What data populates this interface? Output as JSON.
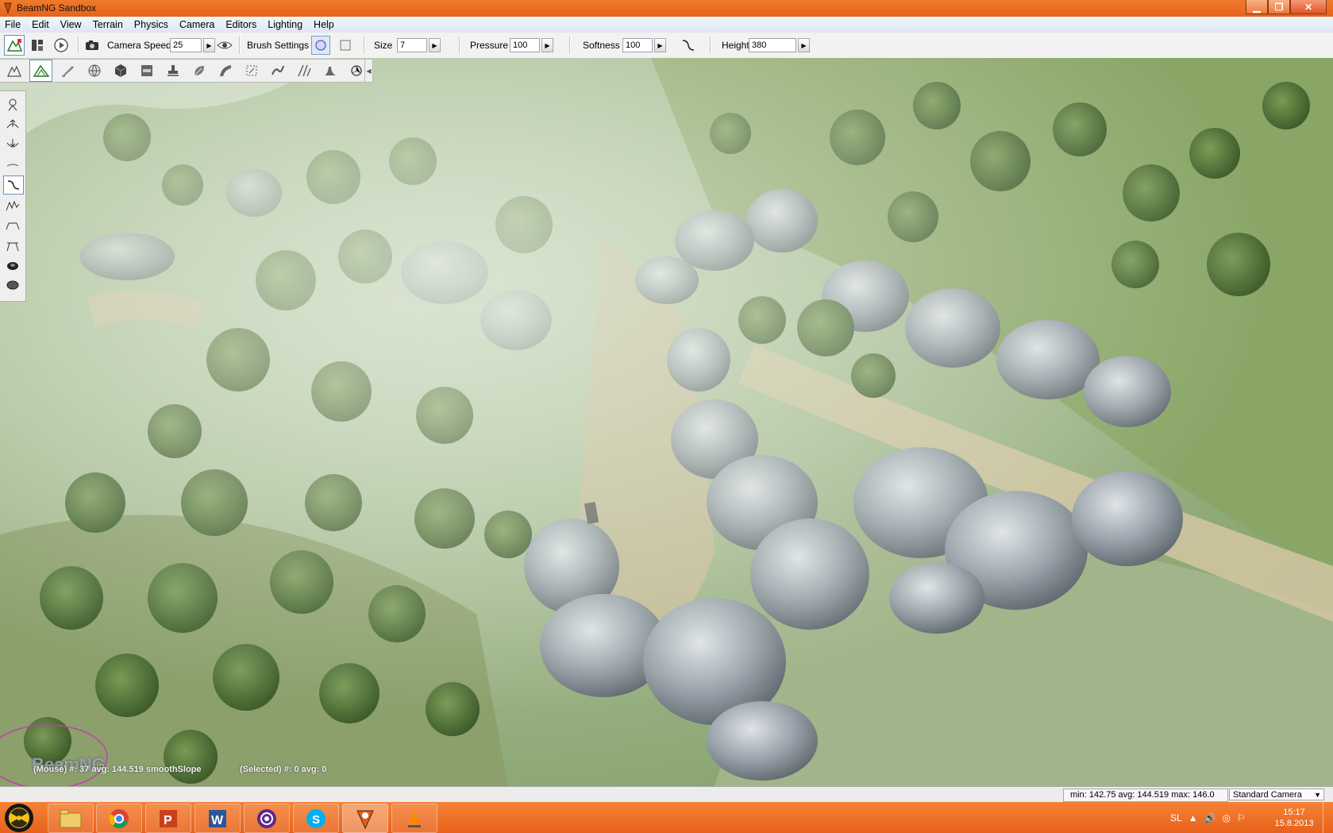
{
  "window": {
    "title": "BeamNG Sandbox"
  },
  "menu": [
    "File",
    "Edit",
    "View",
    "Terrain",
    "Physics",
    "Camera",
    "Editors",
    "Lighting",
    "Help"
  ],
  "toolbar": {
    "camera_speed_label": "Camera Speed",
    "camera_speed_value": "25",
    "brush_settings_label": "Brush Settings",
    "size_label": "Size",
    "size_value": "7",
    "pressure_label": "Pressure",
    "pressure_value": "100",
    "softness_label": "Softness",
    "softness_value": "100",
    "height_label": "Height",
    "height_value": "380"
  },
  "viewport": {
    "mouse_info": "(Mouse) #: 37  avg: 144.519 smoothSlope",
    "selected_info": "(Selected) #: 0  avg: 0",
    "watermark": "BeamNG"
  },
  "status": {
    "stats": "min: 142.75  avg: 144.519  max: 146.0",
    "camera": "Standard Camera"
  },
  "taskbar": {
    "language": "SL",
    "time": "15:17",
    "date": "15.8.2013"
  }
}
